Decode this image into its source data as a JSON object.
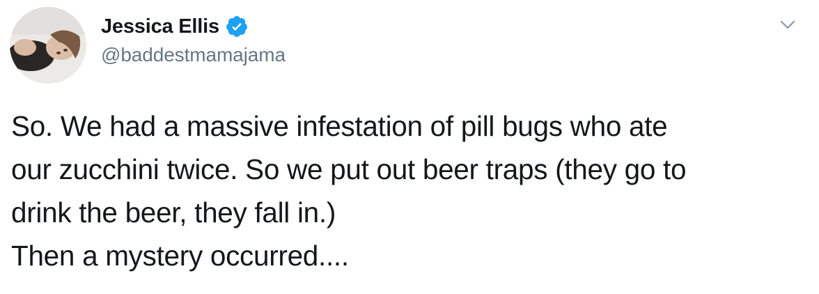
{
  "tweet": {
    "author": {
      "display_name": "Jessica Ellis",
      "handle": "@baddestmamajama",
      "verified": true,
      "avatar": "profile-photo"
    },
    "menu_icon": "chevron-down-icon",
    "text_lines": [
      "So. We had a massive infestation of pill bugs who ate",
      "our zucchini twice. So we put out beer traps (they go to",
      "drink the beer, they fall in.)",
      "Then a mystery occurred...."
    ]
  },
  "colors": {
    "text": "#14171a",
    "secondary_text": "#657786",
    "verified_badge": "#1da1f2",
    "menu_icon": "#8899a6",
    "background": "#ffffff"
  }
}
